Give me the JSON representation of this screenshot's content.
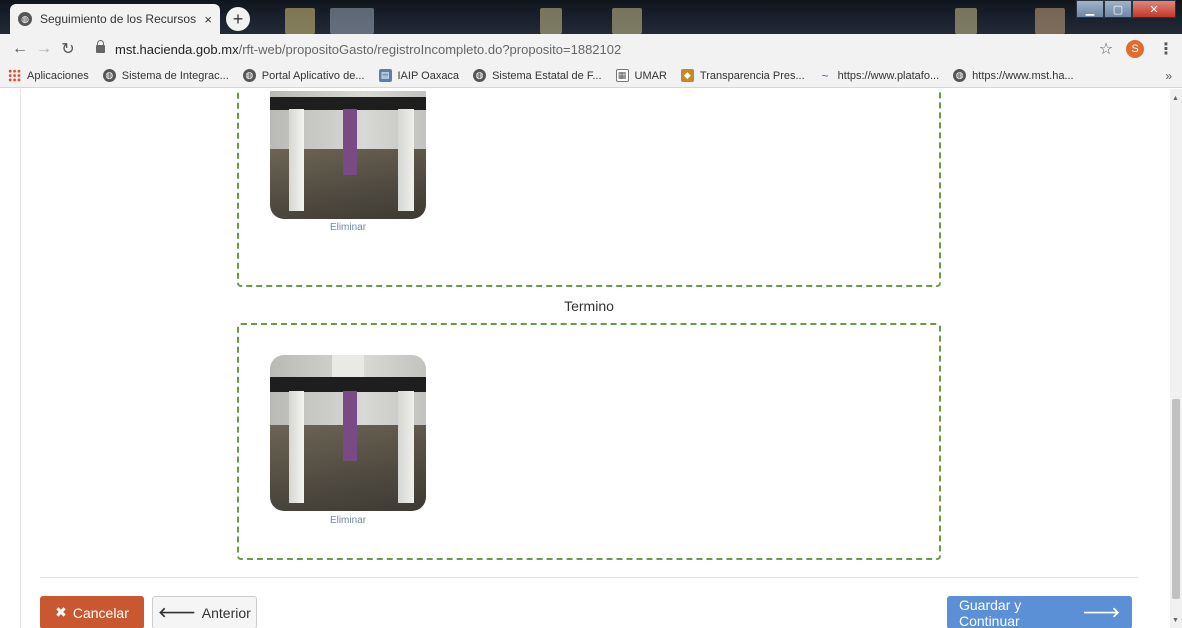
{
  "browser": {
    "tab_title": "Seguimiento de los Recursos Fe",
    "tab_close": "×",
    "new_tab": "+",
    "url_host": "mst.hacienda.gob.mx",
    "url_path": "/rft-web/propositoGasto/registroIncompleto.do?proposito=1882102",
    "profile_initial": "S",
    "bookmarks": [
      {
        "label": "Aplicaciones",
        "icon": "apps-icon"
      },
      {
        "label": "Sistema de Integrac...",
        "icon": "globe-icon"
      },
      {
        "label": "Portal Aplicativo de...",
        "icon": "globe-icon"
      },
      {
        "label": "IAIP Oaxaca",
        "icon": "doc-icon"
      },
      {
        "label": "Sistema Estatal de F...",
        "icon": "globe-icon"
      },
      {
        "label": "UMAR",
        "icon": "calendar-icon"
      },
      {
        "label": "Transparencia Pres...",
        "icon": "cube-icon"
      },
      {
        "label": "https://www.platafo...",
        "icon": "swoosh-icon"
      },
      {
        "label": "https://www.mst.ha...",
        "icon": "globe-icon"
      }
    ],
    "bookmarks_more": "»"
  },
  "content": {
    "photo1_delete": "Eliminar",
    "section_label": "Termino",
    "photo2_delete": "Eliminar"
  },
  "footer": {
    "cancel_label": "Cancelar",
    "previous_label": "Anterior",
    "next_label": "Guardar y Continuar"
  },
  "colors": {
    "cancel": "#c9572f",
    "next": "#5b8fd6",
    "dashed_border": "#6a9a43",
    "link": "#7088a8"
  }
}
